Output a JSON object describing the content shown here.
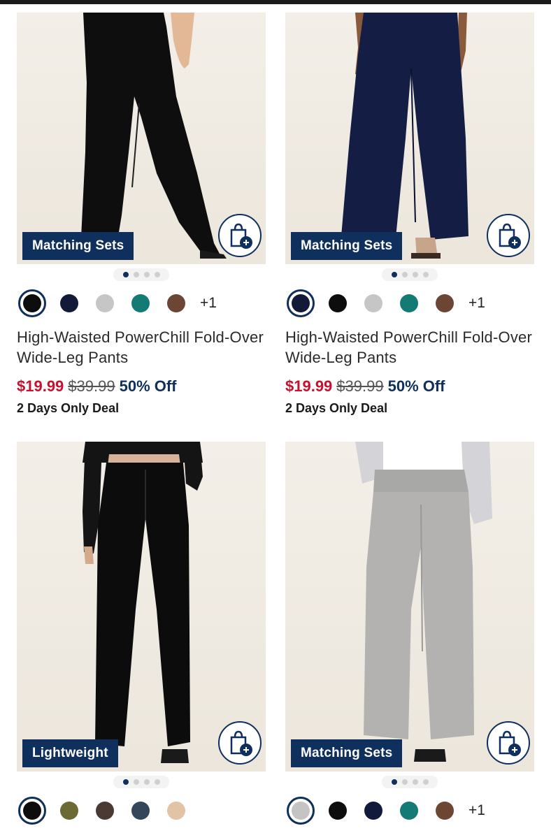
{
  "products": [
    {
      "badge": "Matching Sets",
      "colors": [
        "#0d0d0d",
        "#121a3a",
        "#c6c6c6",
        "#137a76",
        "#6d4633"
      ],
      "more": "+1",
      "name": "High-Waisted PowerChill Fold-Over Wide-Leg Pants",
      "sale_price": "$19.99",
      "original_price": "$39.99",
      "discount": "50% Off",
      "deal": "2 Days Only Deal"
    },
    {
      "badge": "Matching Sets",
      "colors": [
        "#121a3a",
        "#0d0d0d",
        "#c6c6c6",
        "#137a76",
        "#6d4633"
      ],
      "more": "+1",
      "name": "High-Waisted PowerChill Fold-Over Wide-Leg Pants",
      "sale_price": "$19.99",
      "original_price": "$39.99",
      "discount": "50% Off",
      "deal": "2 Days Only Deal"
    },
    {
      "badge": "Lightweight",
      "colors": [
        "#0d0d0d",
        "#6b6a35",
        "#4a3a33",
        "#34465a",
        "#e0c4a5"
      ]
    },
    {
      "badge": "Matching Sets",
      "colors": [
        "#c4c4c4",
        "#0d0d0d",
        "#121a3a",
        "#137a76",
        "#6d4633"
      ],
      "more": "+1"
    }
  ],
  "icons": {
    "add_to_bag": "shopping-bag-plus-icon"
  },
  "theme": {
    "navy": "#0f2f5c",
    "sale_red": "#c8102e"
  }
}
